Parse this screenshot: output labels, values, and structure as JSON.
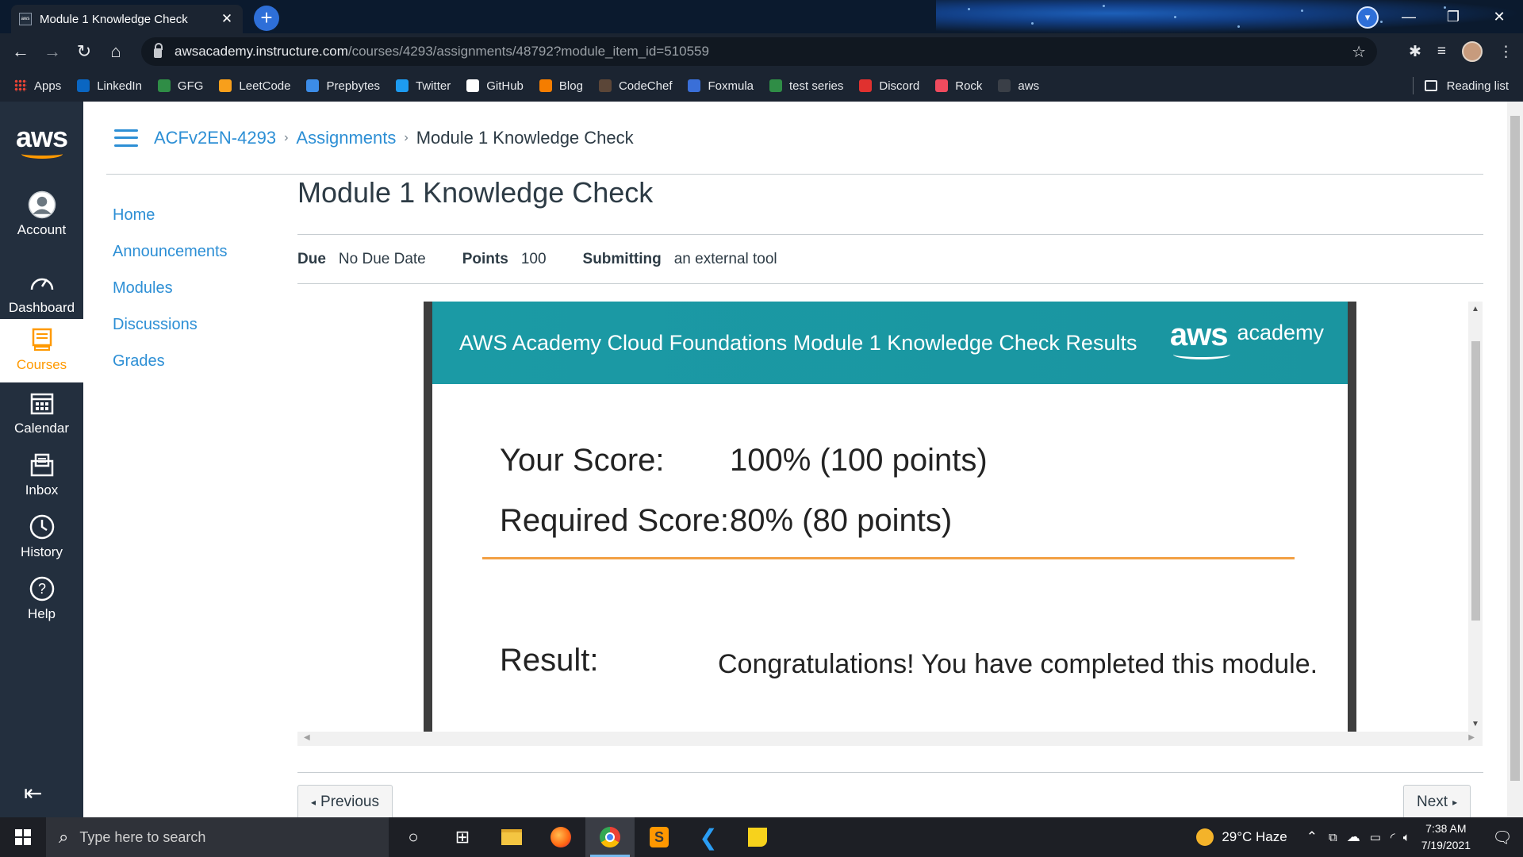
{
  "browser": {
    "tab_title": "Module 1 Knowledge Check",
    "tab_favicon": "aws",
    "url_host": "awsacademy.instructure.com",
    "url_path": "/courses/4293/assignments/48792?module_item_id=510559",
    "bookmarks": [
      {
        "label": "Apps",
        "icon": "apps-grid-icon",
        "color": "#e8eaed"
      },
      {
        "label": "LinkedIn",
        "icon": "linkedin-icon",
        "color": "#0a66c2"
      },
      {
        "label": "GFG",
        "icon": "gfg-icon",
        "color": "#2f8d46"
      },
      {
        "label": "LeetCode",
        "icon": "leetcode-icon",
        "color": "#f89f1b"
      },
      {
        "label": "Prepbytes",
        "icon": "prepbytes-icon",
        "color": "#3c8ce7"
      },
      {
        "label": "Twitter",
        "icon": "twitter-icon",
        "color": "#1d9bf0"
      },
      {
        "label": "GitHub",
        "icon": "github-icon",
        "color": "#ffffff"
      },
      {
        "label": "Blog",
        "icon": "blogger-icon",
        "color": "#f57d00"
      },
      {
        "label": "CodeChef",
        "icon": "codechef-icon",
        "color": "#5b4638"
      },
      {
        "label": "Foxmula",
        "icon": "foxmula-icon",
        "color": "#3a6fd8"
      },
      {
        "label": "test series",
        "icon": "gfg-icon",
        "color": "#2f8d46"
      },
      {
        "label": "Discord",
        "icon": "discord-icon",
        "color": "#e0312f"
      },
      {
        "label": "Rock",
        "icon": "rock-icon",
        "color": "#ef4b5e"
      },
      {
        "label": "aws",
        "icon": "aws-icon",
        "color": "#3a3f47"
      }
    ],
    "reading_list": "Reading list"
  },
  "canvas": {
    "global_nav": [
      {
        "label": "Account",
        "icon": "account-icon"
      },
      {
        "label": "Dashboard",
        "icon": "dashboard-icon"
      },
      {
        "label": "Courses",
        "icon": "courses-icon"
      },
      {
        "label": "Calendar",
        "icon": "calendar-icon"
      },
      {
        "label": "Inbox",
        "icon": "inbox-icon"
      },
      {
        "label": "History",
        "icon": "history-icon"
      },
      {
        "label": "Help",
        "icon": "help-icon"
      }
    ],
    "logo_text": "aws",
    "breadcrumb": {
      "course": "ACFv2EN-4293",
      "section": "Assignments",
      "current": "Module 1 Knowledge Check"
    },
    "course_nav": [
      "Home",
      "Announcements",
      "Modules",
      "Discussions",
      "Grades"
    ],
    "assignment": {
      "title": "Module 1 Knowledge Check",
      "due_label": "Due",
      "due_value": "No Due Date",
      "points_label": "Points",
      "points_value": "100",
      "submitting_label": "Submitting",
      "submitting_value": "an external tool"
    },
    "results": {
      "header": "AWS Academy Cloud Foundations Module 1 Knowledge Check Results",
      "logo_aws": "aws",
      "logo_academy": "academy",
      "score_label": "Your Score:",
      "score_value": "100% (100 points)",
      "required_label": "Required Score:",
      "required_value": "80% (80 points)",
      "result_label": "Result:",
      "result_message": "Congratulations! You have completed this module."
    },
    "pager": {
      "previous": "Previous",
      "next": "Next"
    }
  },
  "taskbar": {
    "search_placeholder": "Type here to search",
    "weather": "29°C  Haze",
    "time": "7:38 AM",
    "date": "7/19/2021"
  },
  "colors": {
    "canvas_nav": "#232f3e",
    "link": "#2d8fd5",
    "aws_orange": "#ff9900",
    "results_header": "#1b9aa5"
  }
}
